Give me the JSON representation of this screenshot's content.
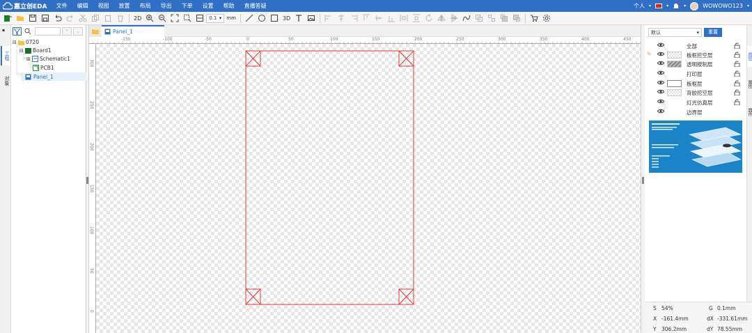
{
  "app": {
    "logo_text": "嘉立创EDA",
    "menus": [
      "文件",
      "编辑",
      "视图",
      "放置",
      "布局",
      "导出",
      "下单",
      "设置",
      "帮助",
      "直播答疑"
    ],
    "user_mode": "个人",
    "username": "WOWOWO123"
  },
  "toolbar": {
    "view_2d": "2D",
    "view_3d": "3D",
    "grid_value": "0.1",
    "unit": "mm"
  },
  "left_tabs": [
    "工程",
    "对象"
  ],
  "tree": [
    {
      "label": "0720",
      "type": "folder"
    },
    {
      "label": "Board1",
      "type": "board"
    },
    {
      "label": "Schematic1",
      "type": "schematic"
    },
    {
      "label": "PCB1",
      "type": "pcb"
    },
    {
      "label": "Panel_1",
      "type": "panel",
      "selected": true
    }
  ],
  "doc_tab": "Panel_1",
  "ruler": {
    "top_labels": [
      "-150",
      "-100",
      "-50",
      "0",
      "50",
      "100",
      "150",
      "200",
      "250",
      "300",
      "350",
      "400",
      "450"
    ],
    "left_labels": [
      "300",
      "250",
      "200",
      "150",
      "100",
      "50",
      "0"
    ]
  },
  "right_panel": {
    "preset": "默认",
    "reset_button": "重置",
    "layers": [
      {
        "name": "全部",
        "swatch": "none"
      },
      {
        "name": "板框挖空层",
        "swatch": "checker"
      },
      {
        "name": "透明按制层",
        "swatch": "hatch"
      },
      {
        "name": "打印层",
        "swatch": "none"
      },
      {
        "name": "板框层",
        "swatch": "white"
      },
      {
        "name": "背胶挖空层",
        "swatch": "checker"
      },
      {
        "name": "灯光仿真层",
        "swatch": "none"
      },
      {
        "name": "边界层",
        "swatch": "none"
      }
    ],
    "right_tabs": [
      "图层",
      "属性",
      "器件"
    ]
  },
  "status": {
    "s_label": "S",
    "s_value": "54%",
    "g_label": "G",
    "g_value": "0.1mm",
    "x_label": "X",
    "x_value": "-161.4mm",
    "dx_label": "dX",
    "dx_value": "-331.61mm",
    "y_label": "Y",
    "y_value": "306.2mm",
    "dy_label": "dY",
    "dy_value": "78.55mm"
  },
  "colors": {
    "menubar": "#2f6fc7",
    "board_outline": "#e23b3b",
    "accent": "#2f6fc7"
  }
}
